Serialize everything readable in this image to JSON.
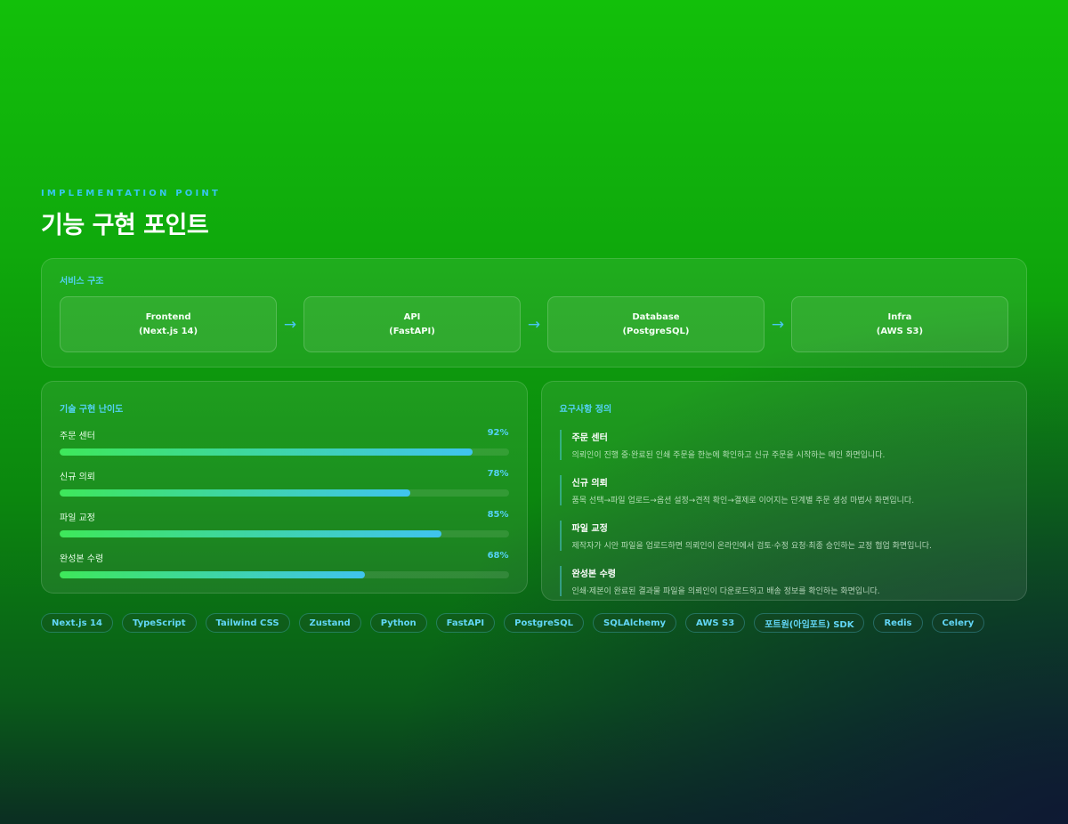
{
  "header": {
    "eyebrow": "IMPLEMENTATION POINT",
    "title": "기능 구현 포인트"
  },
  "architecture": {
    "label": "서비스 구조",
    "nodes": [
      {
        "name": "Frontend",
        "tech": "(Next.js 14)"
      },
      {
        "name": "API",
        "tech": "(FastAPI)"
      },
      {
        "name": "Database",
        "tech": "(PostgreSQL)"
      },
      {
        "name": "Infra",
        "tech": "(AWS S3)"
      }
    ],
    "arrow": "→"
  },
  "difficulty": {
    "label": "기술 구현 난이도",
    "items": [
      {
        "name": "주문 센터",
        "percent_label": "92%",
        "value": 92
      },
      {
        "name": "신규 의뢰",
        "percent_label": "78%",
        "value": 78
      },
      {
        "name": "파일 교정",
        "percent_label": "85%",
        "value": 85
      },
      {
        "name": "완성본 수령",
        "percent_label": "68%",
        "value": 68
      }
    ]
  },
  "requirements": {
    "label": "요구사항 정의",
    "items": [
      {
        "title": "주문 센터",
        "desc": "의뢰인이 진행 중·완료된 인쇄 주문을 한눈에 확인하고 신규 주문을 시작하는 메인 화면입니다."
      },
      {
        "title": "신규 의뢰",
        "desc": "품목 선택→파일 업로드→옵션 설정→견적 확인→결제로 이어지는 단계별 주문 생성 마법사 화면입니다."
      },
      {
        "title": "파일 교정",
        "desc": "제작자가 시안 파일을 업로드하면 의뢰인이 온라인에서 검토·수정 요청·최종 승인하는 교정 협업 화면입니다."
      },
      {
        "title": "완성본 수령",
        "desc": "인쇄·제본이 완료된 결과물 파일을 의뢰인이 다운로드하고 배송 정보를 확인하는 화면입니다."
      }
    ]
  },
  "tags": [
    "Next.js 14",
    "TypeScript",
    "Tailwind CSS",
    "Zustand",
    "Python",
    "FastAPI",
    "PostgreSQL",
    "SQLAlchemy",
    "AWS S3",
    "포트원(아임포트) SDK",
    "Redis",
    "Celery"
  ],
  "colors": {
    "accent": "#38c6ef",
    "bar_start": "#3ee85a",
    "bar_end": "#3fc4ef",
    "bg_top": "#12c00a",
    "bg_bottom": "#0b1a2e"
  }
}
